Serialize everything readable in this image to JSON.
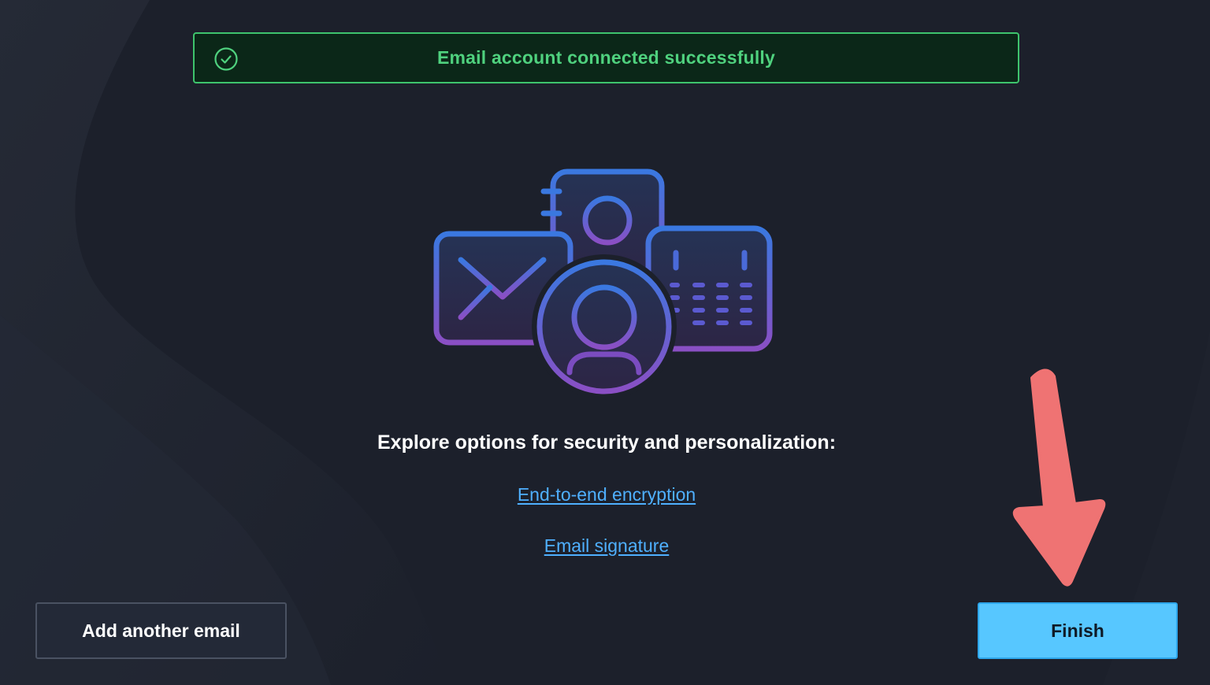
{
  "banner": {
    "message": "Email account connected successfully",
    "icon": "check-circle-icon",
    "color": "#4fd17e"
  },
  "illustration": {
    "icons": [
      "contact-card-icon",
      "envelope-icon",
      "calendar-icon",
      "user-avatar-icon"
    ]
  },
  "main": {
    "headline": "Explore options for security and personalization:",
    "links": [
      {
        "label": "End-to-end encryption"
      },
      {
        "label": "Email signature"
      }
    ]
  },
  "footer": {
    "add_label": "Add another email",
    "finish_label": "Finish",
    "finish_color": "#57c7ff"
  },
  "annotation": {
    "icon": "red-arrow-icon",
    "color": "#ef7373"
  }
}
